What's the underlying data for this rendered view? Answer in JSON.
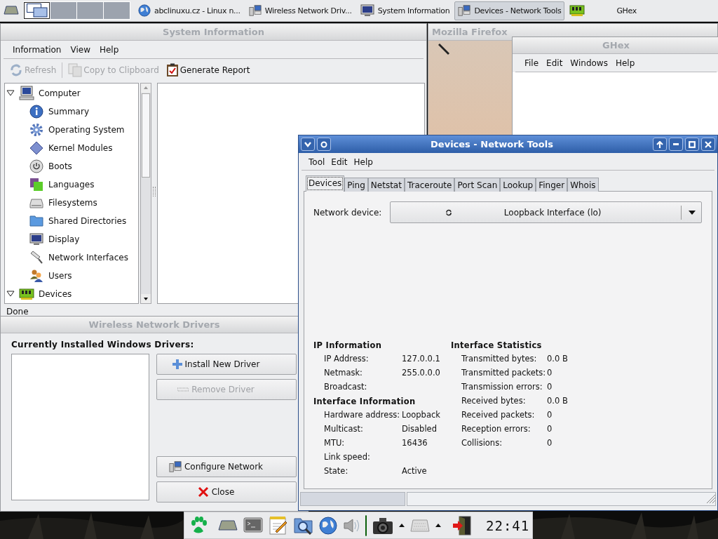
{
  "top_panel": {
    "workspaces": [
      {
        "selected": true
      },
      {
        "selected": false
      },
      {
        "selected": false
      },
      {
        "selected": false
      }
    ],
    "tasks": [
      {
        "label": "abclinuxu.cz - Linux n...",
        "selected": false
      },
      {
        "label": "Wireless Network Driv...",
        "selected": false
      },
      {
        "label": "System Information",
        "selected": false
      },
      {
        "label": "Devices - Network Tools",
        "selected": true
      },
      {
        "label": "GHex",
        "selected": false
      }
    ]
  },
  "system_information": {
    "title": "System Information",
    "active": false,
    "menu": [
      "Information",
      "View",
      "Help"
    ],
    "toolbar": [
      {
        "label": "Refresh",
        "disabled": true
      },
      {
        "label": "Copy to Clipboard",
        "disabled": true
      },
      {
        "label": "Generate Report",
        "disabled": false
      }
    ],
    "tree": [
      {
        "label": "Computer",
        "expanded": true,
        "children": [
          {
            "label": "Summary"
          },
          {
            "label": "Operating System"
          },
          {
            "label": "Kernel Modules"
          },
          {
            "label": "Boots"
          },
          {
            "label": "Languages"
          },
          {
            "label": "Filesystems"
          },
          {
            "label": "Shared Directories"
          },
          {
            "label": "Display"
          },
          {
            "label": "Network Interfaces"
          },
          {
            "label": "Users"
          }
        ]
      },
      {
        "label": "Devices",
        "expanded": true
      }
    ],
    "status": "Done"
  },
  "firefox": {
    "title": "Mozilla Firefox",
    "active": false
  },
  "ghex": {
    "title": "GHex",
    "active": false,
    "menu": [
      "File",
      "Edit",
      "Windows",
      "Help"
    ]
  },
  "wireless_drivers": {
    "title": "Wireless Network Drivers",
    "active": false,
    "heading": "Currently Installed Windows Drivers:",
    "buttons": [
      {
        "label": "Install New Driver",
        "disabled": false
      },
      {
        "label": "Remove Driver",
        "disabled": true
      },
      {
        "label": "Configure Network",
        "disabled": false
      },
      {
        "label": "Close",
        "disabled": false
      }
    ]
  },
  "network_tools": {
    "title": "Devices - Network Tools",
    "active": true,
    "menu": [
      "Tool",
      "Edit",
      "Help"
    ],
    "tabs": [
      {
        "label": "Devices",
        "selected": true
      },
      {
        "label": "Ping",
        "selected": false
      },
      {
        "label": "Netstat",
        "selected": false
      },
      {
        "label": "Traceroute",
        "selected": false
      },
      {
        "label": "Port Scan",
        "selected": false
      },
      {
        "label": "Lookup",
        "selected": false
      },
      {
        "label": "Finger",
        "selected": false
      },
      {
        "label": "Whois",
        "selected": false
      }
    ],
    "device_label": "Network device:",
    "device_value": "Loopback Interface (lo)",
    "left_sections": [
      {
        "title": "IP Information",
        "rows": [
          {
            "label": "IP Address:",
            "value": "127.0.0.1"
          },
          {
            "label": "Netmask:",
            "value": "255.0.0.0"
          },
          {
            "label": "Broadcast:",
            "value": ""
          }
        ]
      },
      {
        "title": "Interface Information",
        "rows": [
          {
            "label": "Hardware address:",
            "value": "Loopback"
          },
          {
            "label": "Multicast:",
            "value": "Disabled"
          },
          {
            "label": "MTU:",
            "value": "16436"
          },
          {
            "label": "Link speed:",
            "value": ""
          },
          {
            "label": "State:",
            "value": "Active"
          }
        ]
      }
    ],
    "right_sections": [
      {
        "title": "Interface Statistics",
        "rows": [
          {
            "label": "Transmitted bytes:",
            "value": "0.0 B"
          },
          {
            "label": "Transmitted packets:",
            "value": "0"
          },
          {
            "label": "Transmission errors:",
            "value": "0"
          },
          {
            "label": "Received bytes:",
            "value": "0.0 B"
          },
          {
            "label": "Received packets:",
            "value": "0"
          },
          {
            "label": "Reception errors:",
            "value": "0"
          },
          {
            "label": "Collisions:",
            "value": "0"
          }
        ]
      }
    ]
  },
  "bottom_panel": {
    "clock": "22:41"
  }
}
